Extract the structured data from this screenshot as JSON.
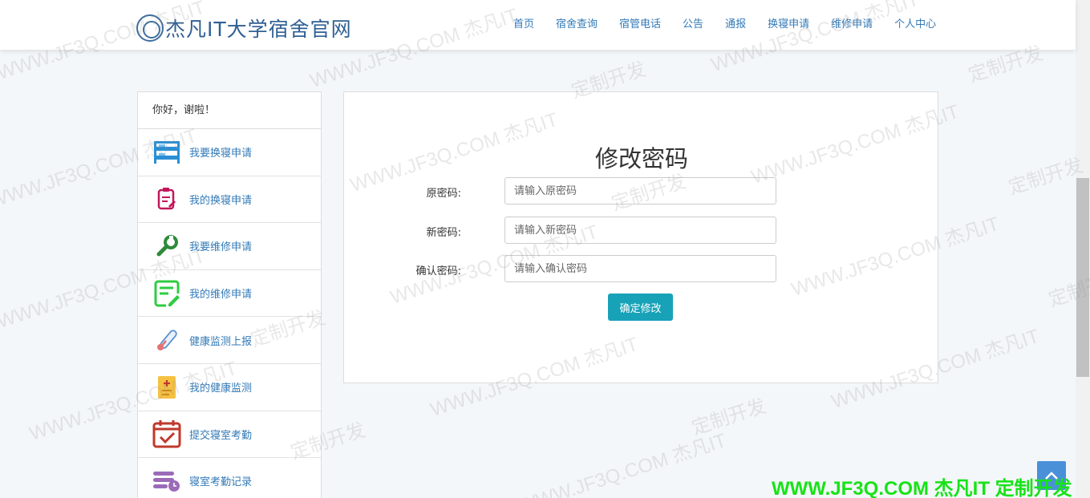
{
  "header": {
    "site_title": "杰凡IT大学宿舍官网",
    "nav": [
      {
        "label": "首页"
      },
      {
        "label": "宿舍查询"
      },
      {
        "label": "宿管电话"
      },
      {
        "label": "公告"
      },
      {
        "label": "通报"
      },
      {
        "label": "换寝申请"
      },
      {
        "label": "维修申请"
      },
      {
        "label": "个人中心"
      }
    ]
  },
  "sidebar": {
    "greeting": "你好，谢啦！",
    "items": [
      {
        "label": "我要换寝申请",
        "icon": "bunk-bed-icon"
      },
      {
        "label": "我的换寝申请",
        "icon": "clipboard-icon"
      },
      {
        "label": "我要维修申请",
        "icon": "wrench-icon"
      },
      {
        "label": "我的维修申请",
        "icon": "note-edit-icon"
      },
      {
        "label": "健康监测上报",
        "icon": "thermometer-icon"
      },
      {
        "label": "我的健康监测",
        "icon": "health-card-icon"
      },
      {
        "label": "提交寝室考勤",
        "icon": "calendar-check-icon"
      },
      {
        "label": "寝室考勤记录",
        "icon": "records-clock-icon"
      }
    ]
  },
  "form": {
    "title": "修改密码",
    "fields": [
      {
        "label": "原密码:",
        "placeholder": "请输入原密码",
        "value": ""
      },
      {
        "label": "新密码:",
        "placeholder": "请输入新密码",
        "value": ""
      },
      {
        "label": "确认密码:",
        "placeholder": "请输入确认密码",
        "value": ""
      }
    ],
    "submit_label": "确定修改"
  },
  "watermark": {
    "text_a": "WWW.JF3Q.COM 杰凡IT",
    "text_b": "定制开发",
    "footer": "WWW.JF3Q.COM 杰凡IT  定制开发"
  },
  "colors": {
    "link": "#337ab7",
    "button": "#17a2b8",
    "footer_watermark": "#17e317",
    "back_to_top": "#4a90d9"
  }
}
